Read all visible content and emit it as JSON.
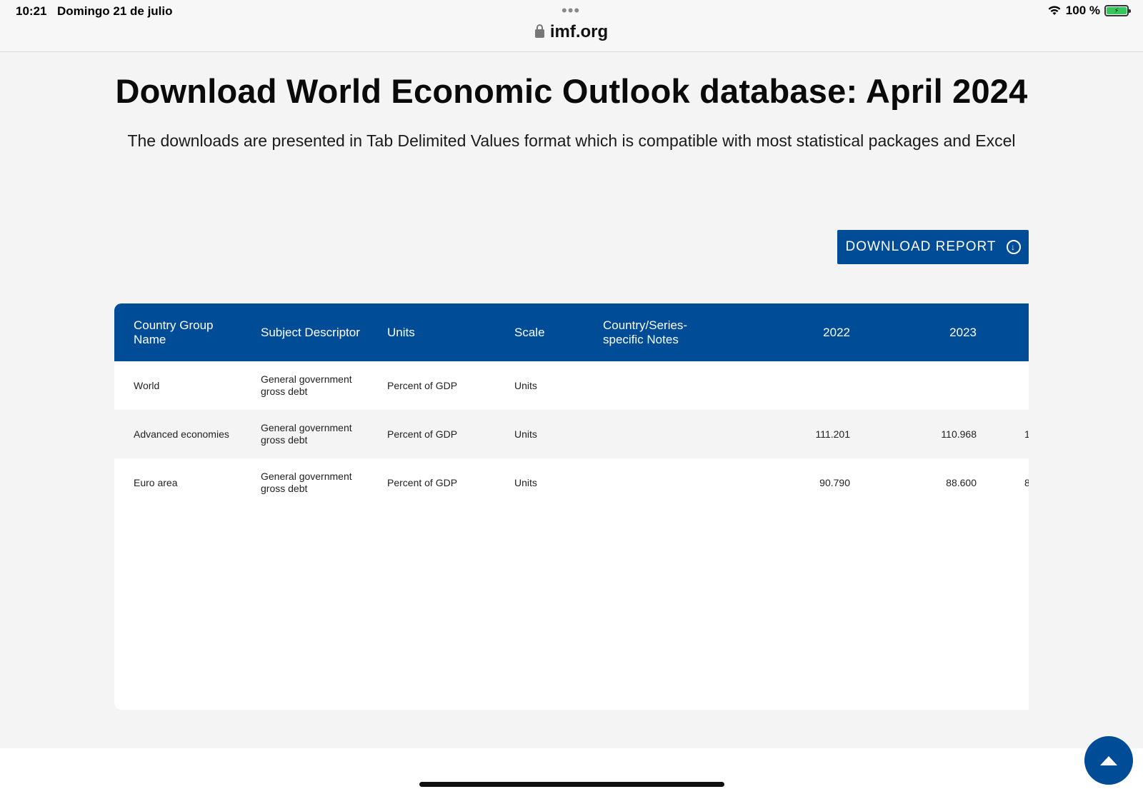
{
  "status": {
    "time": "10:21",
    "date": "Domingo 21 de julio",
    "battery_text": "100 %"
  },
  "browser": {
    "url": "imf.org"
  },
  "page": {
    "title": "Download World Economic Outlook database: April 2024",
    "subtitle": "The downloads are presented in Tab Delimited Values format which is compatible with most statistical packages and Excel",
    "download_button": "DOWNLOAD REPORT"
  },
  "table": {
    "headers": [
      "Country Group Name",
      "Subject Descriptor",
      "Units",
      "Scale",
      "Country/Series-specific Notes",
      "2022",
      "2023"
    ],
    "rows": [
      {
        "group": "World",
        "subject": "General government gross debt",
        "units": "Percent of GDP",
        "scale": "Units",
        "notes": "",
        "y2022": "",
        "y2023": "",
        "next": ""
      },
      {
        "group": "Advanced economies",
        "subject": "General government gross debt",
        "units": "Percent of GDP",
        "scale": "Units",
        "notes": "",
        "y2022": "111.201",
        "y2023": "110.968",
        "next": "1"
      },
      {
        "group": "Euro area",
        "subject": "General government gross debt",
        "units": "Percent of GDP",
        "scale": "Units",
        "notes": "",
        "y2022": "90.790",
        "y2023": "88.600",
        "next": "8"
      }
    ]
  },
  "icons": {
    "lock": "lock-icon",
    "download": "download-circle-icon",
    "scroll_top": "arrow-up-icon"
  }
}
